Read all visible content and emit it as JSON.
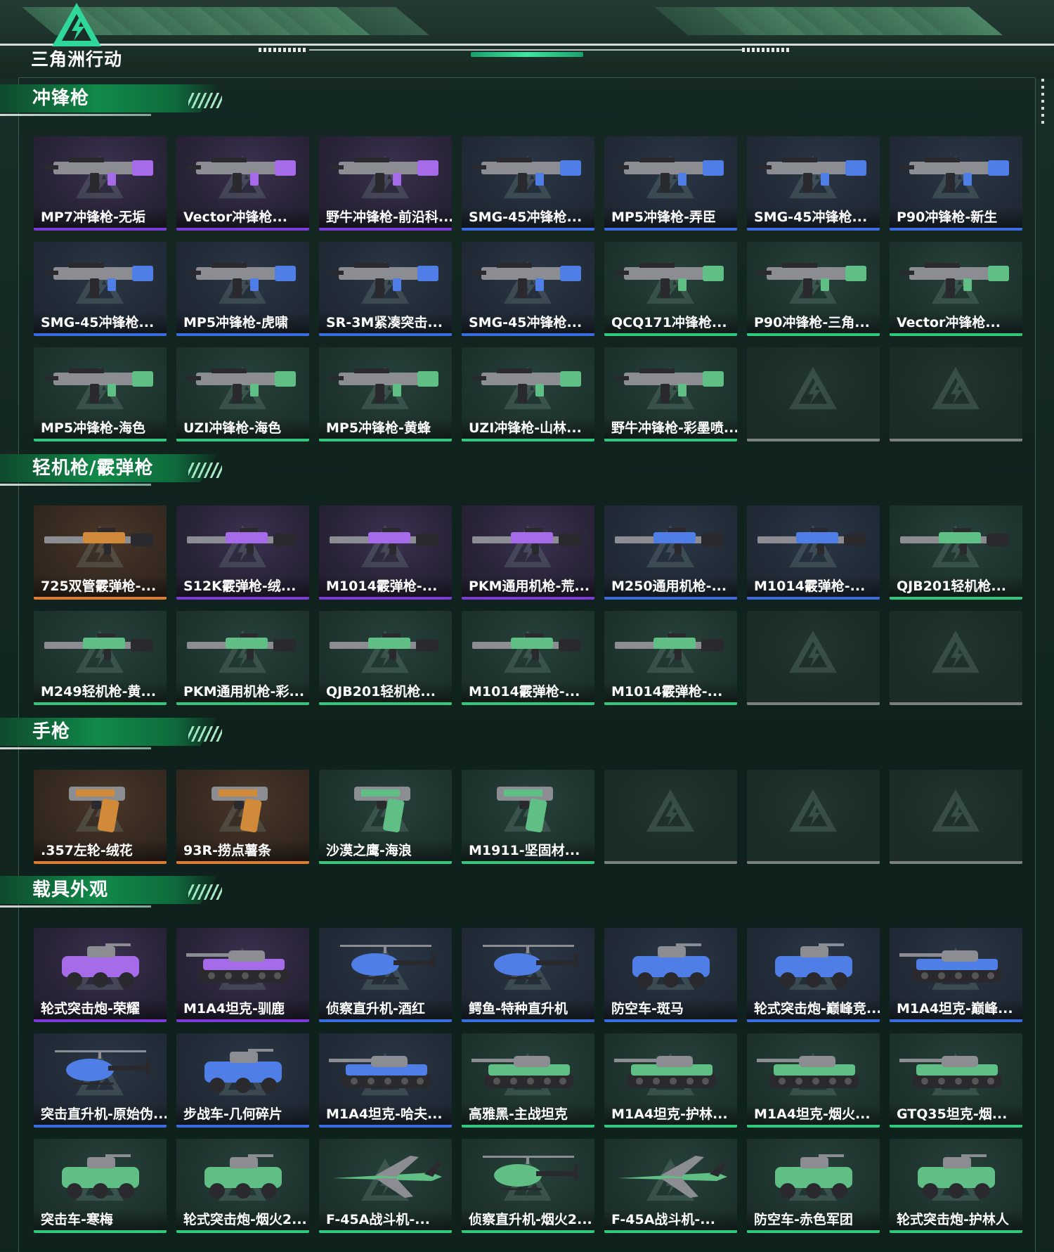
{
  "logo": {
    "text": "三角洲行动",
    "icon": "delta-logo-icon"
  },
  "sections": [
    {
      "title": "冲锋枪",
      "cards": [
        {
          "label": "MP7冲锋枪-无垢",
          "rarity": "purple",
          "kind": "smg"
        },
        {
          "label": "Vector冲锋枪...",
          "rarity": "purple",
          "kind": "smg"
        },
        {
          "label": "野牛冲锋枪-前沿科...",
          "rarity": "purple",
          "kind": "smg"
        },
        {
          "label": "SMG-45冲锋枪...",
          "rarity": "blue",
          "kind": "smg"
        },
        {
          "label": "MP5冲锋枪-弄臣",
          "rarity": "blue",
          "kind": "smg"
        },
        {
          "label": "SMG-45冲锋枪...",
          "rarity": "blue",
          "kind": "smg"
        },
        {
          "label": "P90冲锋枪-新生",
          "rarity": "blue",
          "kind": "smg"
        },
        {
          "label": "SMG-45冲锋枪...",
          "rarity": "blue",
          "kind": "smg"
        },
        {
          "label": "MP5冲锋枪-虎啸",
          "rarity": "blue",
          "kind": "smg"
        },
        {
          "label": "SR-3M紧凑突击...",
          "rarity": "blue",
          "kind": "smg"
        },
        {
          "label": "SMG-45冲锋枪...",
          "rarity": "blue",
          "kind": "smg"
        },
        {
          "label": "QCQ171冲锋枪...",
          "rarity": "green",
          "kind": "smg"
        },
        {
          "label": "P90冲锋枪-三角...",
          "rarity": "green",
          "kind": "smg"
        },
        {
          "label": "Vector冲锋枪...",
          "rarity": "green",
          "kind": "smg"
        },
        {
          "label": "MP5冲锋枪-海色",
          "rarity": "green",
          "kind": "smg"
        },
        {
          "label": "UZI冲锋枪-海色",
          "rarity": "green",
          "kind": "smg"
        },
        {
          "label": "MP5冲锋枪-黄蜂",
          "rarity": "green",
          "kind": "smg"
        },
        {
          "label": "UZI冲锋枪-山林...",
          "rarity": "green",
          "kind": "smg"
        },
        {
          "label": "野牛冲锋枪-彩墨喷...",
          "rarity": "green",
          "kind": "smg"
        },
        {
          "label": "",
          "rarity": "empty",
          "kind": "empty"
        },
        {
          "label": "",
          "rarity": "empty",
          "kind": "empty"
        }
      ]
    },
    {
      "title": "轻机枪/霰弹枪",
      "cards": [
        {
          "label": "725双管霰弹枪-...",
          "rarity": "orange",
          "kind": "rifle"
        },
        {
          "label": "S12K霰弹枪-绒...",
          "rarity": "purple",
          "kind": "rifle"
        },
        {
          "label": "M1014霰弹枪-...",
          "rarity": "purple",
          "kind": "rifle"
        },
        {
          "label": "PKM通用机枪-荒...",
          "rarity": "purple",
          "kind": "rifle"
        },
        {
          "label": "M250通用机枪-...",
          "rarity": "blue",
          "kind": "rifle"
        },
        {
          "label": "M1014霰弹枪-...",
          "rarity": "blue",
          "kind": "rifle"
        },
        {
          "label": "QJB201轻机枪...",
          "rarity": "green",
          "kind": "rifle"
        },
        {
          "label": "M249轻机枪-黄...",
          "rarity": "green",
          "kind": "rifle"
        },
        {
          "label": "PKM通用机枪-彩...",
          "rarity": "green",
          "kind": "rifle"
        },
        {
          "label": "QJB201轻机枪...",
          "rarity": "green",
          "kind": "rifle"
        },
        {
          "label": "M1014霰弹枪-...",
          "rarity": "green",
          "kind": "rifle"
        },
        {
          "label": "M1014霰弹枪-...",
          "rarity": "green",
          "kind": "rifle"
        },
        {
          "label": "",
          "rarity": "empty",
          "kind": "empty"
        },
        {
          "label": "",
          "rarity": "empty",
          "kind": "empty"
        }
      ]
    },
    {
      "title": "手枪",
      "cards": [
        {
          "label": ".357左轮-绒花",
          "rarity": "orange",
          "kind": "pistol"
        },
        {
          "label": "93R-捞点薯条",
          "rarity": "orange",
          "kind": "pistol"
        },
        {
          "label": "沙漠之鹰-海浪",
          "rarity": "green",
          "kind": "pistol"
        },
        {
          "label": "M1911-坚固材...",
          "rarity": "green",
          "kind": "pistol"
        },
        {
          "label": "",
          "rarity": "empty",
          "kind": "empty"
        },
        {
          "label": "",
          "rarity": "empty",
          "kind": "empty"
        },
        {
          "label": "",
          "rarity": "empty",
          "kind": "empty"
        }
      ]
    },
    {
      "title": "载具外观",
      "cards": [
        {
          "label": "轮式突击炮-荣耀",
          "rarity": "purple",
          "kind": "vehicle"
        },
        {
          "label": "M1A4坦克-驯鹿",
          "rarity": "purple",
          "kind": "tank"
        },
        {
          "label": "侦察直升机-酒红",
          "rarity": "blue",
          "kind": "heli"
        },
        {
          "label": "鳄鱼-特种直升机",
          "rarity": "blue",
          "kind": "heli"
        },
        {
          "label": "防空车-斑马",
          "rarity": "blue",
          "kind": "vehicle"
        },
        {
          "label": "轮式突击炮-巅峰竞...",
          "rarity": "blue",
          "kind": "vehicle"
        },
        {
          "label": "M1A4坦克-巅峰...",
          "rarity": "blue",
          "kind": "tank"
        },
        {
          "label": "突击直升机-原始伪...",
          "rarity": "blue",
          "kind": "heli"
        },
        {
          "label": "步战车-几何碎片",
          "rarity": "blue",
          "kind": "vehicle"
        },
        {
          "label": "M1A4坦克-哈夫...",
          "rarity": "blue",
          "kind": "tank"
        },
        {
          "label": "高雅黑-主战坦克",
          "rarity": "green",
          "kind": "tank"
        },
        {
          "label": "M1A4坦克-护林...",
          "rarity": "green",
          "kind": "tank"
        },
        {
          "label": "M1A4坦克-烟火...",
          "rarity": "green",
          "kind": "tank"
        },
        {
          "label": "GTQ35坦克-烟...",
          "rarity": "green",
          "kind": "tank"
        },
        {
          "label": "突击车-寒梅",
          "rarity": "green",
          "kind": "vehicle"
        },
        {
          "label": "轮式突击炮-烟火2...",
          "rarity": "green",
          "kind": "vehicle"
        },
        {
          "label": "F-45A战斗机-...",
          "rarity": "green",
          "kind": "jet"
        },
        {
          "label": "侦察直升机-烟火2...",
          "rarity": "green",
          "kind": "heli"
        },
        {
          "label": "F-45A战斗机-...",
          "rarity": "green",
          "kind": "jet"
        },
        {
          "label": "防空车-赤色军团",
          "rarity": "green",
          "kind": "vehicle"
        },
        {
          "label": "轮式突击炮-护林人",
          "rarity": "green",
          "kind": "vehicle"
        }
      ]
    }
  ],
  "colors": {
    "purple": "#7a3bd6",
    "blue": "#3b6de0",
    "green": "#2fc87c",
    "orange": "#e07b2a",
    "empty": "#7c817e",
    "accent": "#118a4a"
  }
}
